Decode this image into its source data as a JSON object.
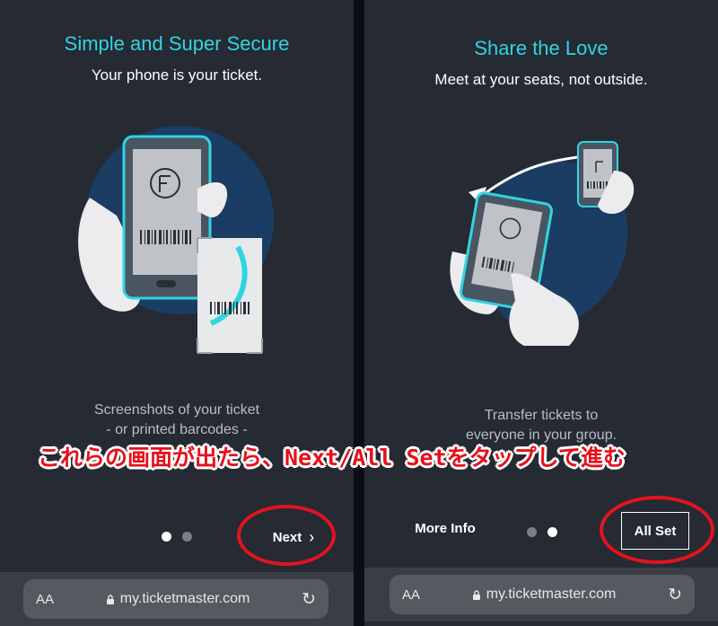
{
  "left": {
    "title": "Simple and Super Secure",
    "subtitle": "Your phone is your ticket.",
    "caption_lines": [
      "Screenshots of your ticket",
      "- or printed barcodes -"
    ],
    "next_label": "Next",
    "next_icon": "chevron-right-icon",
    "page_indicator": {
      "total": 2,
      "active_index": 0
    }
  },
  "right": {
    "title": "Share the Love",
    "subtitle": "Meet at your seats, not outside.",
    "caption_lines": [
      "Transfer tickets to",
      "everyone in your group."
    ],
    "more_info_label": "More Info",
    "all_set_label": "All Set",
    "page_indicator": {
      "total": 2,
      "active_index": 1
    }
  },
  "browser": {
    "aa_label": "AA",
    "url": "my.ticketmaster.com",
    "lock_icon": "lock-icon",
    "reload_icon": "reload-icon"
  },
  "annotation": {
    "text": "これらの画面が出たら、Next/All Setをタップして進む",
    "color": "#e6101c"
  },
  "colors": {
    "background": "#252a33",
    "accent": "#2fd5e0",
    "annotation_red": "#e0141f"
  }
}
